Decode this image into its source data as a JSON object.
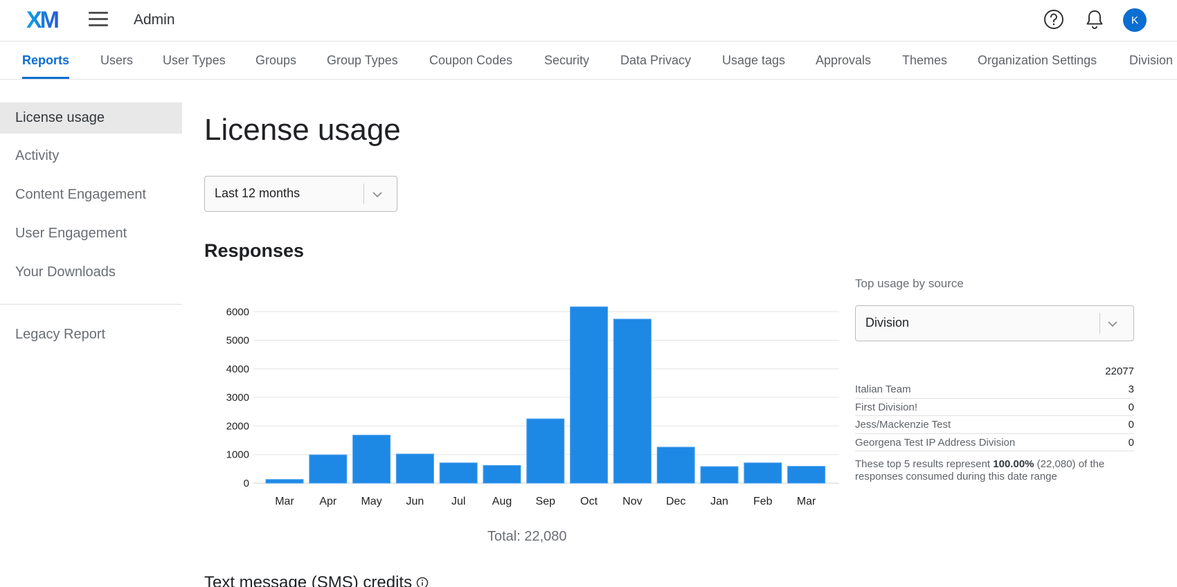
{
  "header": {
    "logo_text": "XM",
    "app_title": "Admin",
    "avatar_initial": "K"
  },
  "tabs": [
    {
      "label": "Reports",
      "active": true
    },
    {
      "label": "Users"
    },
    {
      "label": "User Types"
    },
    {
      "label": "Groups"
    },
    {
      "label": "Group Types"
    },
    {
      "label": "Coupon Codes"
    },
    {
      "label": "Security"
    },
    {
      "label": "Data Privacy"
    },
    {
      "label": "Usage tags"
    },
    {
      "label": "Approvals"
    },
    {
      "label": "Themes"
    },
    {
      "label": "Organization Settings"
    },
    {
      "label": "Division"
    }
  ],
  "sidebar": {
    "items": [
      {
        "label": "License usage",
        "active": true
      },
      {
        "label": "Activity"
      },
      {
        "label": "Content Engagement"
      },
      {
        "label": "User Engagement"
      },
      {
        "label": "Your Downloads"
      }
    ],
    "legacy": {
      "label": "Legacy Report"
    }
  },
  "main": {
    "page_title": "License usage",
    "date_range": {
      "value": "Last 12 months"
    },
    "responses_title": "Responses",
    "total_text": "Total: 22,080",
    "sms_title": "Text message (SMS) credits"
  },
  "chart_data": {
    "type": "bar",
    "categories": [
      "Mar",
      "Apr",
      "May",
      "Jun",
      "Jul",
      "Aug",
      "Sep",
      "Oct",
      "Nov",
      "Dec",
      "Jan",
      "Feb",
      "Mar"
    ],
    "values": [
      130,
      990,
      1680,
      1020,
      710,
      620,
      2250,
      6170,
      5740,
      1260,
      580,
      710,
      590
    ],
    "yticks": [
      0,
      1000,
      2000,
      3000,
      4000,
      5000,
      6000
    ],
    "ylim": [
      0,
      6200
    ],
    "title": "",
    "xlabel": "",
    "ylabel": "",
    "grid": true,
    "color": "#1e88e5"
  },
  "source_panel": {
    "label": "Top usage by source",
    "select_value": "Division",
    "total": "22077",
    "rows": [
      {
        "name": "Italian Team",
        "count": "3"
      },
      {
        "name": "First Division!",
        "count": "0"
      },
      {
        "name": "Jess/Mackenzie Test",
        "count": "0"
      },
      {
        "name": "Georgena Test IP Address Division",
        "count": "0"
      }
    ],
    "note_prefix": "These top 5 results represent ",
    "note_percent": "100.00%",
    "note_suffix": " (22,080) of the responses consumed during this date range"
  },
  "colors": {
    "accent": "#0b6ed1",
    "bar": "#1e88e5",
    "logo_gradient_start": "#0aa4e6",
    "logo_gradient_end": "#2b56d6"
  },
  "icons": [
    "menu-icon",
    "help-icon",
    "bell-icon",
    "chevron-down-icon",
    "info-icon"
  ]
}
